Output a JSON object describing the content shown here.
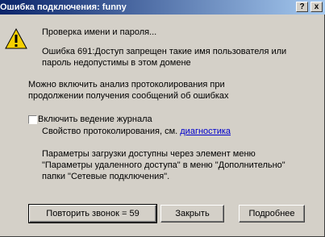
{
  "window": {
    "title": "Ошибка подключения: funny"
  },
  "titlebar_buttons": {
    "help": "?",
    "close": "x"
  },
  "icon": "warning-icon",
  "messages": {
    "checking": "Проверка имени и пароля...",
    "error_line1": "Ошибка 691:Доступ запрещен такие имя пользователя или",
    "error_line2": "пароль недопустимы в этом домене",
    "analysis_line1": "Можно включить анализ протоколирования при",
    "analysis_line2": "продолжении получения сообщений об ошибках"
  },
  "logging": {
    "checkbox_label": "Включить ведение журнала",
    "properties_text": "Свойство протоколирования, см.",
    "link_text": "диагностика"
  },
  "info": {
    "line1": "Параметры загрузки доступны через элемент меню",
    "line2": "\"Параметры удаленного доступа\" в меню \"Дополнительно\"",
    "line3": "папки \"Сетевые подключения\"."
  },
  "buttons": {
    "redial": "Повторить звонок = 59",
    "close": "Закрыть",
    "more": "Подробнее"
  }
}
